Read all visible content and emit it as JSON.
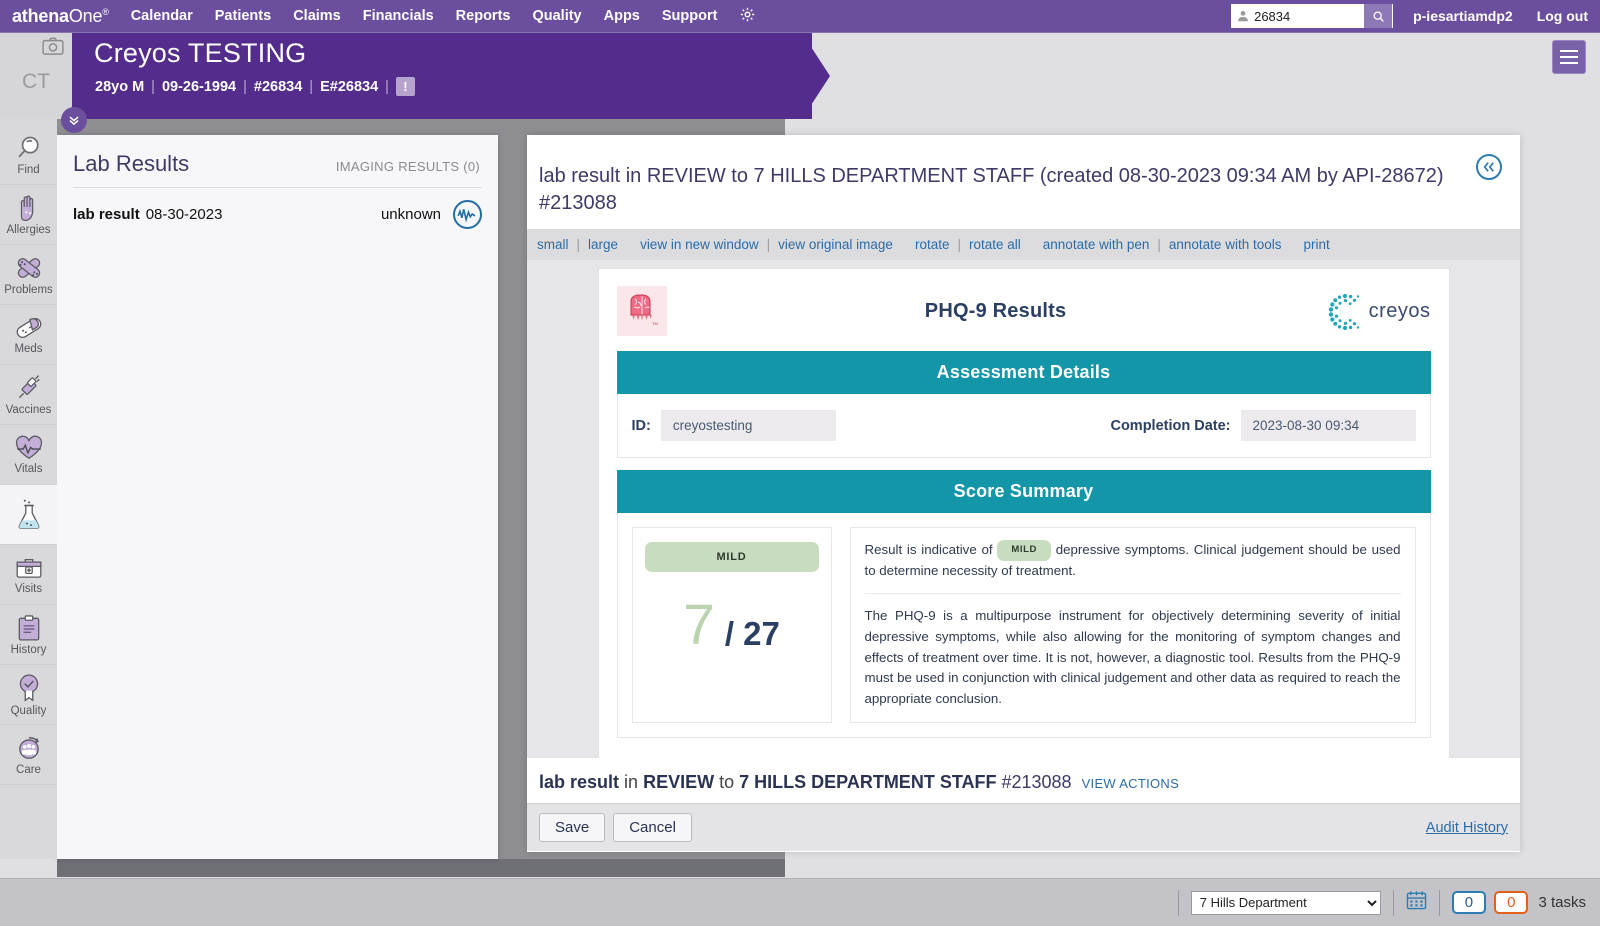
{
  "topnav": {
    "brand_bold": "athena",
    "brand_light": "One",
    "brand_sup": "®",
    "items": [
      {
        "label": "Calendar"
      },
      {
        "label": "Patients"
      },
      {
        "label": "Claims"
      },
      {
        "label": "Financials"
      },
      {
        "label": "Reports"
      },
      {
        "label": "Quality"
      },
      {
        "label": "Apps"
      },
      {
        "label": "Support"
      }
    ],
    "gear_icon": "gear-icon",
    "search_value": "26834",
    "search_placeholder": "",
    "search_icon": "search-icon",
    "user": "p-iesartiamdp2",
    "logout": "Log out"
  },
  "patient_banner": {
    "initials": "CT",
    "camera_icon": "camera-icon",
    "name": "Creyos TESTING",
    "age_sex": "28yo M",
    "dob": "09-26-1994",
    "patient_id": "#26834",
    "encounter_id": "E#26834",
    "alert_badge": "!",
    "chevron_icon": "chevron-double-down-icon",
    "menu_icon": "hamburger-menu-icon"
  },
  "rail": {
    "items": [
      {
        "label": "Find",
        "icon": "magnifier-icon",
        "active": false
      },
      {
        "label": "Allergies",
        "icon": "hand-icon",
        "active": false
      },
      {
        "label": "Problems",
        "icon": "bandages-icon",
        "active": false
      },
      {
        "label": "Meds",
        "icon": "pill-icon",
        "active": false
      },
      {
        "label": "Vaccines",
        "icon": "syringe-icon",
        "active": false
      },
      {
        "label": "Vitals",
        "icon": "heart-pulse-icon",
        "active": false
      },
      {
        "label": "",
        "icon": "flask-icon",
        "active": true
      },
      {
        "label": "Visits",
        "icon": "briefcase-icon",
        "active": false
      },
      {
        "label": "History",
        "icon": "clipboard-icon",
        "active": false
      },
      {
        "label": "Quality",
        "icon": "check-ribbon-icon",
        "active": false
      },
      {
        "label": "Care",
        "icon": "care-team-icon",
        "active": false
      }
    ]
  },
  "lab_panel": {
    "title": "Lab Results",
    "imaging_label": "IMAGING RESULTS (0)",
    "rows": [
      {
        "name": "lab result",
        "date": "08-30-2023",
        "status": "unknown",
        "icon": "waveform-icon"
      }
    ]
  },
  "doc": {
    "collapse_icon": "«",
    "title_line1": "lab result in REVIEW to 7 HILLS DEPARTMENT STAFF (created 08-30-2023 09:34 AM by API-28672)",
    "title_line2": "#213088",
    "toolbar": {
      "small": "small",
      "large": "large",
      "view_new_window": "view in new window",
      "view_original": "view original image",
      "rotate": "rotate",
      "rotate_all": "rotate all",
      "annotate_pen": "annotate with pen",
      "annotate_tools": "annotate with tools",
      "print": "print"
    },
    "footer": {
      "name": "lab result",
      "in": "in",
      "status": "REVIEW",
      "to": "to",
      "dept": "7 HILLS DEPARTMENT STAFF",
      "number": "#213088",
      "view_actions": "VIEW ACTIONS",
      "save_label": "Save",
      "cancel_label": "Cancel",
      "audit_label": "Audit History"
    }
  },
  "report": {
    "logo_left": "brain-logo-icon",
    "title": "PHQ-9 Results",
    "logo_right_name": "creyos",
    "logo_right_icon": "creyos-dots-logo-icon",
    "assessment_band": "Assessment Details",
    "id_label": "ID:",
    "id_value": "creyostesting",
    "completion_label": "Completion Date:",
    "completion_value": "2023-08-30 09:34",
    "score_band": "Score Summary",
    "severity": "MILD",
    "score": "7",
    "score_max": "/ 27",
    "interp_pre": "Result is indicative of",
    "interp_pill": "MILD",
    "interp_post": "depressive symptoms. Clinical judgement should be used to determine necessity of treatment.",
    "interp_body": "The PHQ-9 is a multipurpose instrument for objectively determining severity of initial depressive symptoms, while also allowing for the monitoring of symptom changes and effects of treatment over time. It is not, however, a diagnostic tool. Results from the PHQ-9 must be used in conjunction with clinical judgement and other data as required to reach the appropriate conclusion."
  },
  "statusbar": {
    "department": "7 Hills Department",
    "calendar_icon": "calendar-icon",
    "count_blue": "0",
    "count_orange": "0",
    "tasks": "3 tasks"
  },
  "colors": {
    "purple_nav": "#6b4f9e",
    "purple_banner": "#542d8c",
    "teal_band": "#1296a8",
    "severity_green": "#c8dcc0",
    "link_blue": "#2b6ca8",
    "navy": "#2b3f63"
  }
}
